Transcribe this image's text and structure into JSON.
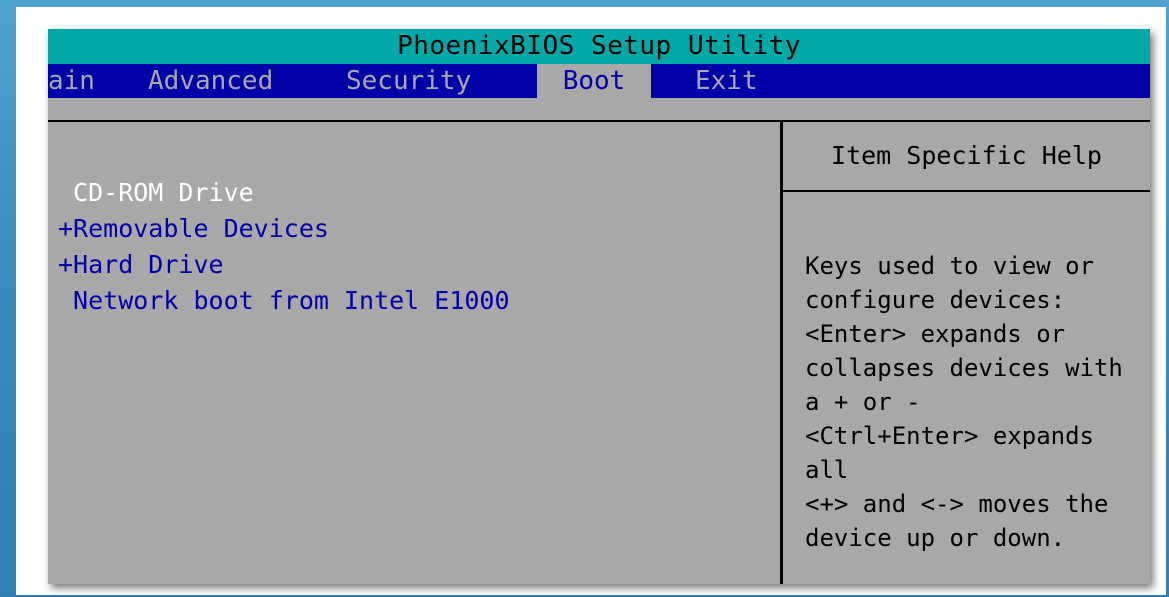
{
  "title": "PhoenixBIOS Setup Utility",
  "menu": [
    {
      "label": "ain",
      "name": "menu-main",
      "selected": false
    },
    {
      "label": "Advanced",
      "name": "menu-advanced",
      "selected": false
    },
    {
      "label": "Security",
      "name": "menu-security",
      "selected": false
    },
    {
      "label": "Boot",
      "name": "menu-boot",
      "selected": true
    },
    {
      "label": "Exit",
      "name": "menu-exit",
      "selected": false
    }
  ],
  "boot_items": [
    {
      "label": " CD-ROM Drive",
      "selected": true
    },
    {
      "label": "+Removable Devices",
      "selected": false
    },
    {
      "label": "+Hard Drive",
      "selected": false
    },
    {
      "label": " Network boot from Intel E1000",
      "selected": false
    }
  ],
  "help": {
    "title": "Item Specific Help",
    "lines": [
      "Keys used to view or",
      "configure devices:",
      "<Enter> expands or",
      "collapses devices with",
      "a + or -",
      "<Ctrl+Enter> expands",
      "all",
      "<+> and <-> moves the",
      "device up or down."
    ]
  },
  "colors": {
    "title_bg": "#00a8a8",
    "menu_bg": "#0000a8",
    "panel_bg": "#a8a8a8",
    "selected_item": "#ffffff",
    "item_text": "#0000a8"
  }
}
